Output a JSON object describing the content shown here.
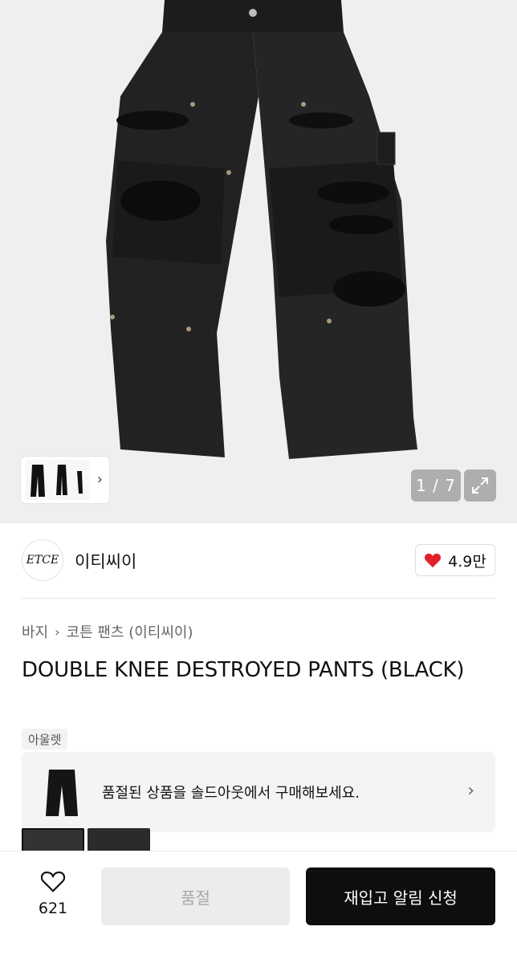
{
  "gallery": {
    "counter": "1 / 7",
    "icons": {
      "expand": "expand-icon",
      "chevron": "chevron-right-icon"
    }
  },
  "brand": {
    "logo_text": "ETCE",
    "name": "이티씨이",
    "likes": "4.9만",
    "like_color": "#e0202a"
  },
  "breadcrumb": {
    "category": "바지",
    "subcategory": "코튼 팬츠 (이티씨이)"
  },
  "product": {
    "title": "DOUBLE KNEE DESTROYED PANTS (BLACK)",
    "badge": "아울렛"
  },
  "soldout_banner": {
    "text": "품절된 상품을 솔드아웃에서 구매해보세요."
  },
  "bottom_bar": {
    "wish_count": "621",
    "soldout_label": "품절",
    "restock_label": "재입고 알림 신청"
  }
}
